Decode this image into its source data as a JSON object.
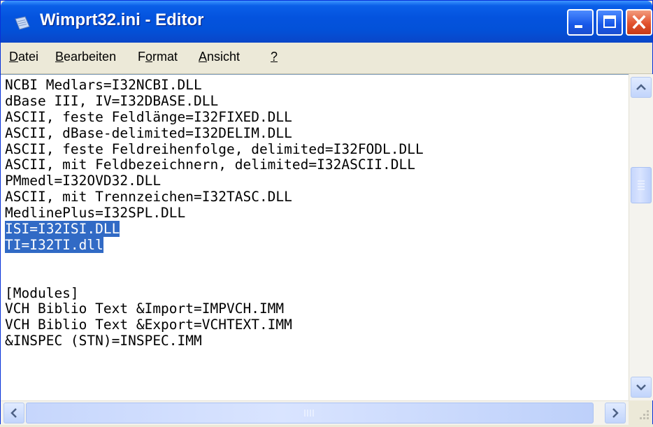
{
  "window": {
    "title": "Wimprt32.ini - Editor",
    "icons": {
      "app": "notepad-icon",
      "minimize": "minimize-icon",
      "maximize": "maximize-icon",
      "close": "close-icon"
    },
    "colors": {
      "titlebar": "#0453de",
      "close_button": "#e2522e",
      "selection": "#316ac5"
    }
  },
  "menu": {
    "items": [
      {
        "label": "Datei",
        "mnemonic": "D"
      },
      {
        "label": "Bearbeiten",
        "mnemonic": "B"
      },
      {
        "label": "Format",
        "mnemonic": "o"
      },
      {
        "label": "Ansicht",
        "mnemonic": "A"
      },
      {
        "label": "?",
        "mnemonic": "?"
      }
    ]
  },
  "editor": {
    "lines": [
      "NCBI Medlars=I32NCBI.DLL",
      "dBase III, IV=I32DBASE.DLL",
      "ASCII, feste Feldlänge=I32FIXED.DLL",
      "ASCII, dBase-delimited=I32DELIM.DLL",
      "ASCII, feste Feldreihenfolge, delimited=I32FODL.DLL",
      "ASCII, mit Feldbezeichnern, delimited=I32ASCII.DLL",
      "PMmedl=I32OVD32.DLL",
      "ASCII, mit Trennzeichen=I32TASC.DLL",
      "MedlinePlus=I32SPL.DLL",
      "ISI=I32ISI.DLL",
      "TI=I32TI.dll",
      "",
      "",
      "[Modules]",
      "VCH Biblio Text &Import=IMPVCH.IMM",
      "VCH Biblio Text &Export=VCHTEXT.IMM",
      "&INSPEC (STN)=INSPEC.IMM"
    ],
    "selected_lines": [
      9,
      10
    ]
  },
  "scrollbars": {
    "vertical": {
      "position": 0.28,
      "up_icon": "arrow-up-icon",
      "down_icon": "arrow-down-icon"
    },
    "horizontal": {
      "position": 0.0,
      "left_icon": "arrow-left-icon",
      "right_icon": "arrow-right-icon"
    }
  }
}
